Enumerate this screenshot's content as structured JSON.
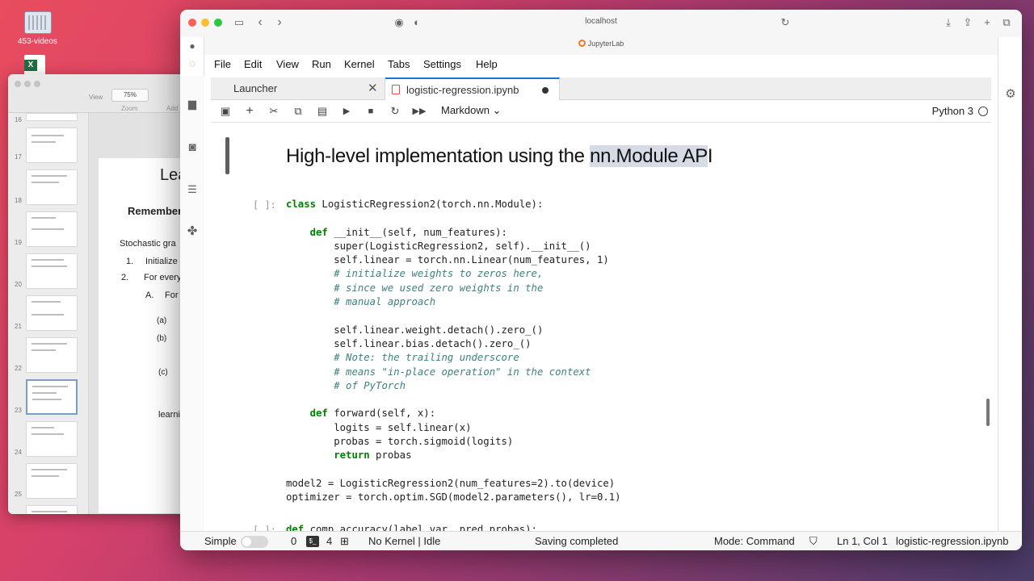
{
  "desktop": {
    "folder_label": "453-videos",
    "file_badge": "X"
  },
  "keynote": {
    "zoom": "75%",
    "view_label": "View",
    "zoom_label": "Zoom",
    "add_label": "Add Slide",
    "slide_numbers": [
      "16",
      "17",
      "18",
      "19",
      "20",
      "21",
      "22",
      "23",
      "24",
      "25"
    ],
    "slide": {
      "title": "Lea",
      "remember": "Remember",
      "stochastic": "Stochastic gra",
      "item1_num": "1.",
      "item1": "Initialize",
      "item2_num": "2.",
      "item2": "For every",
      "itemA_num": "A.",
      "itemA": "For e",
      "a": "(a)",
      "b": "(b)",
      "c": "(c)",
      "learning": "learning"
    }
  },
  "browser": {
    "url": "localhost",
    "page_title": "JupyterLab"
  },
  "menu": [
    "File",
    "Edit",
    "View",
    "Run",
    "Kernel",
    "Tabs",
    "Settings",
    "Help"
  ],
  "tabs": [
    {
      "label": "Launcher",
      "active": false
    },
    {
      "label": "logistic-regression.ipynb",
      "active": true
    }
  ],
  "toolbar": {
    "cell_type": "Markdown",
    "kernel": "Python 3"
  },
  "notebook": {
    "heading_pre": "High-level implementation using the ",
    "heading_hl": "nn.Module AP",
    "heading_post": "I",
    "cell1_prompt": "[ ]:",
    "cell1_code_lines": [
      "class LogisticRegression2(torch.nn.Module):",
      "",
      "    def __init__(self, num_features):",
      "        super(LogisticRegression2, self).__init__()",
      "        self.linear = torch.nn.Linear(num_features, 1)",
      "        # initialize weights to zeros here,",
      "        # since we used zero weights in the",
      "        # manual approach",
      "",
      "        self.linear.weight.detach().zero_()",
      "        self.linear.bias.detach().zero_()",
      "        # Note: the trailing underscore",
      "        # means \"in-place operation\" in the context",
      "        # of PyTorch",
      "",
      "    def forward(self, x):",
      "        logits = self.linear(x)",
      "        probas = torch.sigmoid(logits)",
      "        return probas",
      "",
      "model2 = LogisticRegression2(num_features=2).to(device)",
      "optimizer = torch.optim.SGD(model2.parameters(), lr=0.1)"
    ],
    "cell2_prompt": "[ ]:",
    "cell2_code": "def comp_accuracy(label_var, pred_probas):"
  },
  "status": {
    "mode_label": "Simple",
    "count_a": "0",
    "count_b": "4",
    "kernel_status": "No Kernel | Idle",
    "save_status": "Saving completed",
    "mode": "Mode: Command",
    "position": "Ln 1, Col 1",
    "filename": "logistic-regression.ipynb"
  }
}
